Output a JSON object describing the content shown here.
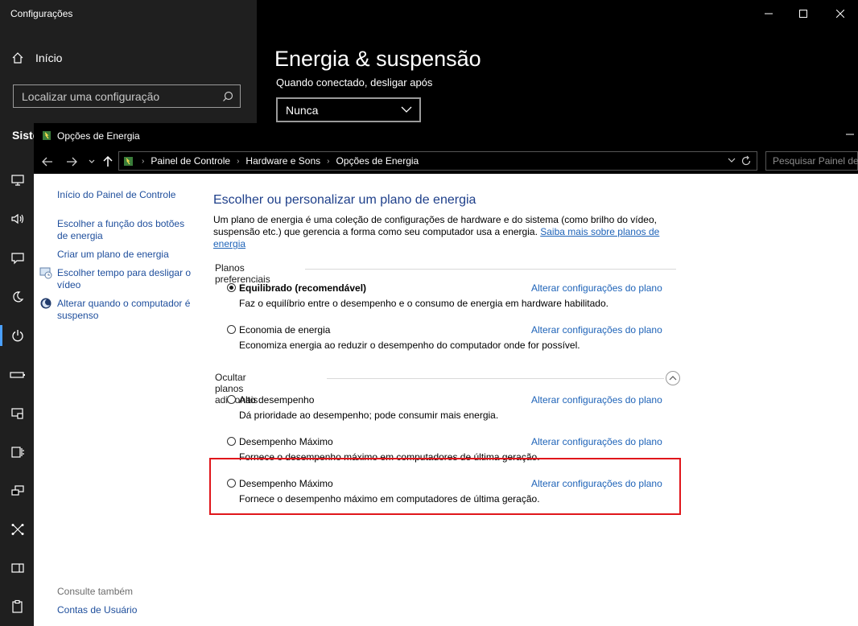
{
  "settings": {
    "window_title": "Configurações",
    "home_label": "Início",
    "search_placeholder": "Localizar uma configuração",
    "section_label": "Siste",
    "page_title": "Energia & suspensão",
    "sub_label": "Quando conectado, desligar após",
    "select_value": "Nunca",
    "rail_icons": [
      "display-icon",
      "sound-icon",
      "notifications-icon",
      "focus-assist-moon-icon",
      "power-icon",
      "battery-icon",
      "storage-icon",
      "tablet-icon",
      "multitasking-icon",
      "projecting-icon",
      "shared-experiences-icon",
      "clipboard-icon"
    ],
    "accent_color": "#4aa0ff"
  },
  "control_panel": {
    "window_title": "Opções de Energia",
    "breadcrumb": [
      "Painel de Controle",
      "Hardware e Sons",
      "Opções de Energia"
    ],
    "search_placeholder": "Pesquisar Painel de C",
    "sidebar": {
      "home_link": "Início do Painel de Controle",
      "links": [
        "Escolher a função dos botões de energia",
        "Criar um plano de energia",
        "Escolher tempo para desligar o vídeo",
        "Alterar quando o computador é suspenso"
      ],
      "see_also_label": "Consulte também",
      "see_also_links": [
        "Contas de Usuário"
      ]
    },
    "heading": "Escolher ou personalizar um plano de energia",
    "description": "Um plano de energia é uma coleção de configurações de hardware e do sistema (como brilho do vídeo, suspensão etc.) que gerencia a forma como seu computador usa a energia.",
    "learn_more_link": "Saiba mais sobre planos de energia",
    "preferred_group_label": "Planos preferenciais",
    "additional_group_label": "Ocultar planos adicionais",
    "change_plan_link": "Alterar configurações do plano",
    "preferred_plans": [
      {
        "name": "Equilibrado (recomendável)",
        "description": "Faz o equilíbrio entre o desempenho e o consumo de energia em hardware habilitado.",
        "selected": true
      },
      {
        "name": "Economia de energia",
        "description": "Economiza energia ao reduzir o desempenho do computador onde for possível.",
        "selected": false
      }
    ],
    "additional_plans": [
      {
        "name": "Alto desempenho",
        "description": "Dá prioridade ao desempenho; pode consumir mais energia.",
        "selected": false
      },
      {
        "name": "Desempenho Máximo",
        "description": "Fornece o desempenho máximo em computadores de última geração.",
        "selected": false
      },
      {
        "name": "Desempenho Máximo",
        "description": "Fornece o desempenho máximo em computadores de última geração.",
        "selected": false
      }
    ],
    "highlight_color": "#e0161b"
  }
}
